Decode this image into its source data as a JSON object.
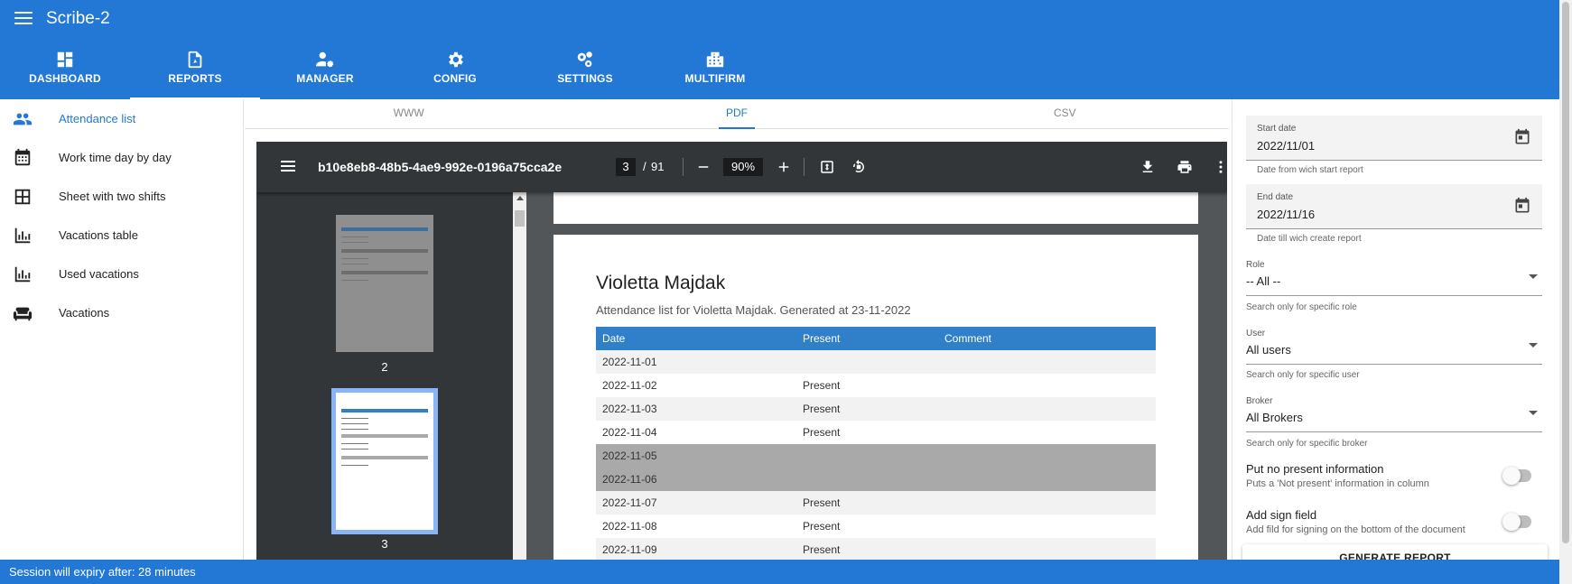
{
  "app": {
    "title": "Scribe-2"
  },
  "nav_tabs": [
    {
      "label": "DASHBOARD",
      "icon": "dashboard-icon"
    },
    {
      "label": "REPORTS",
      "icon": "pdf-icon"
    },
    {
      "label": "MANAGER",
      "icon": "manager-icon"
    },
    {
      "label": "CONFIG",
      "icon": "gear-icon"
    },
    {
      "label": "SETTINGS",
      "icon": "gears-icon"
    },
    {
      "label": "MULTIFIRM",
      "icon": "building-icon"
    }
  ],
  "sidebar": {
    "items": [
      {
        "label": "Attendance list",
        "icon": "people-icon"
      },
      {
        "label": "Work time day by day",
        "icon": "calendar-icon"
      },
      {
        "label": "Sheet with two shifts",
        "icon": "table-icon"
      },
      {
        "label": "Vacations table",
        "icon": "bar-chart-icon"
      },
      {
        "label": "Used vacations",
        "icon": "bar-chart-icon"
      },
      {
        "label": "Vacations",
        "icon": "sofa-icon"
      }
    ]
  },
  "format_tabs": [
    "WWW",
    "PDF",
    "CSV"
  ],
  "viewer": {
    "filename": "b10e8eb8-48b5-4ae9-992e-0196a75cca2e",
    "current_page": "3",
    "separator": "/",
    "total_pages": "91",
    "zoom": "90%",
    "thumb_labels": [
      "2",
      "3"
    ]
  },
  "document": {
    "name": "Violetta Majdak",
    "subtitle": "Attendance list for Violetta Majdak. Generated at 23-11-2022",
    "headers": [
      "Date",
      "Present",
      "Comment"
    ],
    "rows": [
      {
        "date": "2022-11-01",
        "present": "",
        "comment": ""
      },
      {
        "date": "2022-11-02",
        "present": "Present",
        "comment": ""
      },
      {
        "date": "2022-11-03",
        "present": "Present",
        "comment": ""
      },
      {
        "date": "2022-11-04",
        "present": "Present",
        "comment": ""
      },
      {
        "date": "2022-11-05",
        "present": "",
        "comment": ""
      },
      {
        "date": "2022-11-06",
        "present": "",
        "comment": ""
      },
      {
        "date": "2022-11-07",
        "present": "Present",
        "comment": ""
      },
      {
        "date": "2022-11-08",
        "present": "Present",
        "comment": ""
      },
      {
        "date": "2022-11-09",
        "present": "Present",
        "comment": ""
      }
    ]
  },
  "form": {
    "start_date": {
      "label": "Start date",
      "value": "2022/11/01",
      "hint": "Date from wich start report"
    },
    "end_date": {
      "label": "End date",
      "value": "2022/11/16",
      "hint": "Date till wich create report"
    },
    "role": {
      "label": "Role",
      "value": "-- All --",
      "hint": "Search only for specific role"
    },
    "user": {
      "label": "User",
      "value": "All users",
      "hint": "Search only for specific user"
    },
    "broker": {
      "label": "Broker",
      "value": "All Brokers",
      "hint": "Search only for specific broker"
    },
    "no_present": {
      "label": "Put no present information",
      "sub": "Puts a 'Not present' information in column"
    },
    "sign_field": {
      "label": "Add sign field",
      "sub": "Add fild for signing on the bottom of the document"
    },
    "generate_label": "GENERATE REPORT"
  },
  "status": {
    "text": "Session will expiry after: 28 minutes"
  },
  "colors": {
    "primary": "#2378d5",
    "table_header": "#2f80c9",
    "weekend_row": "#a9a9a9",
    "viewer_bg": "#525659",
    "toolbar_bg": "#323639"
  }
}
